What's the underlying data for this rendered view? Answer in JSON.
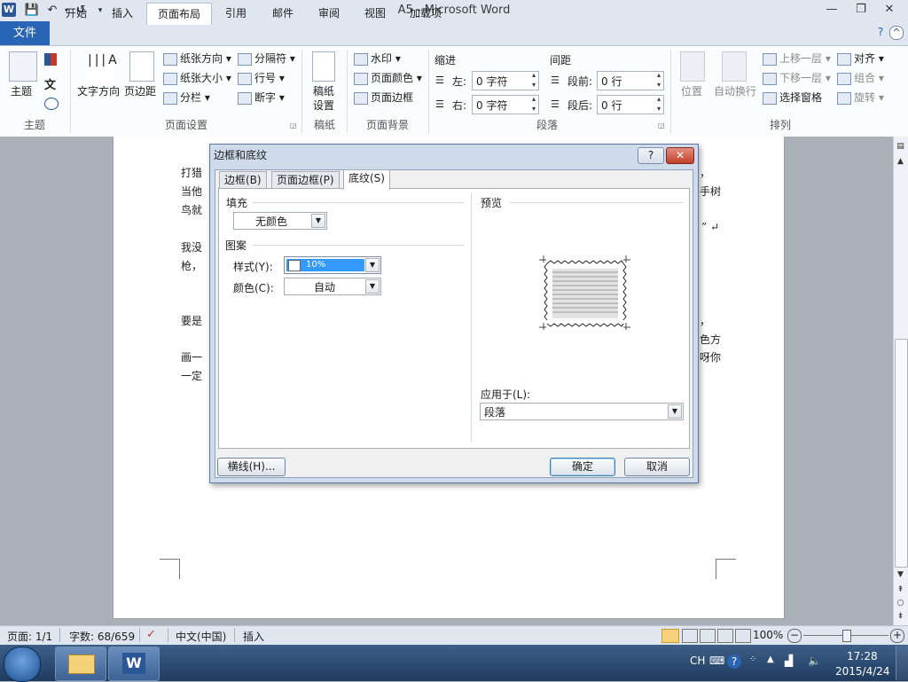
{
  "window": {
    "title": "A5 - Microsoft Word",
    "app_icon": "W"
  },
  "qat": {
    "undo": "↶",
    "redo": "↺"
  },
  "ribbon": {
    "tabs": [
      "文件",
      "开始",
      "插入",
      "页面布局",
      "引用",
      "邮件",
      "审阅",
      "视图",
      "加载项"
    ],
    "active_tab": "页面布局",
    "theme_group": {
      "label": "主题",
      "themes": "主题"
    },
    "page_setup": {
      "label": "页面设置",
      "text_direction": "文字方向",
      "margins": "页边距",
      "orientation": "纸张方向",
      "size": "纸张大小",
      "columns": "分栏",
      "breaks": "分隔符",
      "line_numbers": "行号",
      "hyphenation": "断字"
    },
    "manuscript": {
      "label": "稿纸",
      "setup_line1": "稿纸",
      "setup_line2": "设置"
    },
    "page_background": {
      "label": "页面背景",
      "watermark": "水印",
      "page_color": "页面颜色",
      "page_borders": "页面边框"
    },
    "paragraph": {
      "label": "段落",
      "indent": "缩进",
      "spacing": "间距",
      "left_label": "左:",
      "left_value": "0 字符",
      "right_label": "右:",
      "right_value": "0 字符",
      "before_label": "段前:",
      "before_value": "0 行",
      "after_label": "段后:",
      "after_value": "0 行"
    },
    "arrange": {
      "label": "排列",
      "position": "位置",
      "wrap_text": "自动换行",
      "bring_forward": "上移一层",
      "send_backward": "下移一层",
      "selection_pane": "选择窗格",
      "align": "对齐",
      "group": "组合",
      "rotate": "旋转"
    }
  },
  "document": {
    "lines": [
      {
        "text": "” ↵"
      },
      {
        "text": "打猎"
      },
      {
        "text": "当他"
      },
      {
        "text": "鸟就"
      },
      {
        "text": "” ↵"
      },
      {
        "text": "我没"
      },
      {
        "text": "枪，"
      },
      {
        "text": "要是"
      },
      {
        "text": "画一"
      },
      {
        "text": "一定"
      }
    ],
    "right_fragments": [
      "，",
      "手树",
      "，",
      "色方",
      "呀你"
    ]
  },
  "dialog": {
    "title": "边框和底纹",
    "help_label": "?",
    "close_label": "✕",
    "tabs": [
      "边框(B)",
      "页面边框(P)",
      "底纹(S)"
    ],
    "active_tab": "底纹(S)",
    "fill_label": "填充",
    "fill_value": "无颜色",
    "pattern_label": "图案",
    "style_label": "样式(Y):",
    "style_value": "10%",
    "color_label": "颜色(C):",
    "color_value": "自动",
    "preview_label": "预览",
    "apply_to_label": "应用于(L):",
    "apply_to_value": "段落",
    "horizontal_line_button": "横线(H)...",
    "ok_button": "确定",
    "cancel_button": "取消"
  },
  "statusbar": {
    "page": "页面: 1/1",
    "words": "字数: 68/659",
    "language": "中文(中国)",
    "mode": "插入",
    "zoom": "100%",
    "zoom_minus": "−",
    "zoom_plus": "+"
  },
  "taskbar": {
    "ime": "CH",
    "time": "17:28",
    "date": "2015/4/24"
  },
  "colors": {
    "accent": "#2a64b5",
    "selection": "#3399ff",
    "close_red": "#c2402a"
  }
}
